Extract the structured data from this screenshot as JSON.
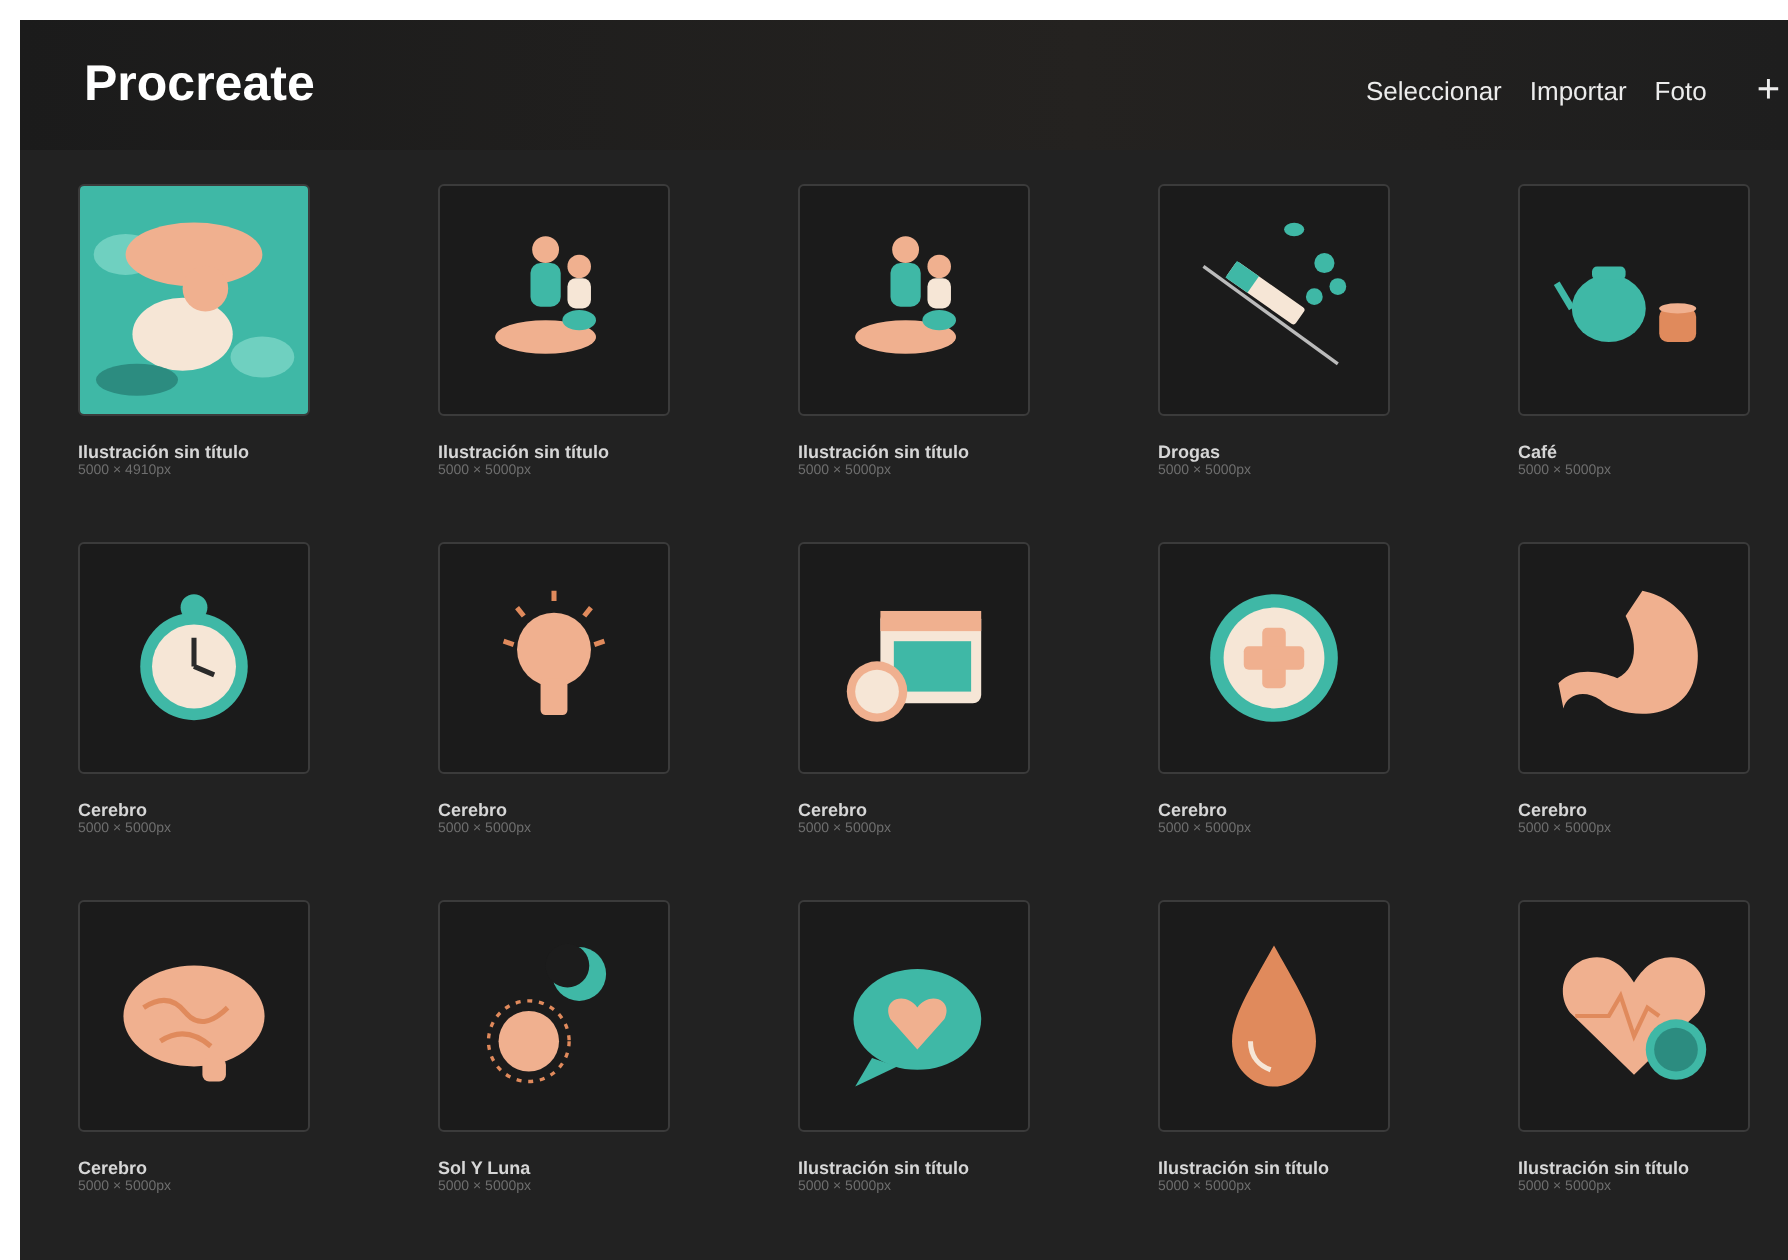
{
  "header": {
    "title": "Procreate",
    "actions": [
      "Seleccionar",
      "Importar",
      "Foto"
    ],
    "add_button": "+"
  },
  "artworks": [
    {
      "title": "Ilustración sin título",
      "size": "5000 × 4910px",
      "kind": "picture"
    },
    {
      "title": "Ilustración sin título",
      "size": "5000 × 5000px",
      "kind": "picture"
    },
    {
      "title": "Ilustración sin título",
      "size": "5000 × 5000px",
      "kind": "picture"
    },
    {
      "title": "Drogas",
      "size": "5000 × 5000px",
      "kind": "picture"
    },
    {
      "title": "Café",
      "size": "5000 × 5000px",
      "kind": "picture"
    },
    {
      "title": "Cerebro",
      "size": "5000 × 5000px",
      "kind": "picture"
    },
    {
      "title": "Cerebro",
      "size": "5000 × 5000px",
      "kind": "picture"
    },
    {
      "title": "Cerebro",
      "size": "5000 × 5000px",
      "kind": "picture"
    },
    {
      "title": "Cerebro",
      "size": "5000 × 5000px",
      "kind": "picture"
    },
    {
      "title": "Cerebro",
      "size": "5000 × 5000px",
      "kind": "picture"
    },
    {
      "title": "Cerebro",
      "size": "5000 × 5000px",
      "kind": "picture"
    },
    {
      "title": "Sol Y Luna",
      "size": "5000 × 5000px",
      "kind": "picture"
    },
    {
      "title": "Ilustración sin título",
      "size": "5000 × 5000px",
      "kind": "picture"
    },
    {
      "title": "Ilustración sin título",
      "size": "5000 × 5000px",
      "kind": "picture"
    },
    {
      "title": "Ilustración sin título",
      "size": "5000 × 5000px",
      "kind": "picture"
    }
  ]
}
